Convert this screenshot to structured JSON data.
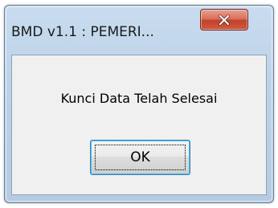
{
  "window": {
    "title": "BMD v1.1 : PEMERI...",
    "close_icon": "close-icon"
  },
  "dialog": {
    "message": "Kunci Data Telah Selesai",
    "ok_label": "OK"
  },
  "colors": {
    "close_button": "#c7452d",
    "focus_border": "#3c7fb1"
  }
}
